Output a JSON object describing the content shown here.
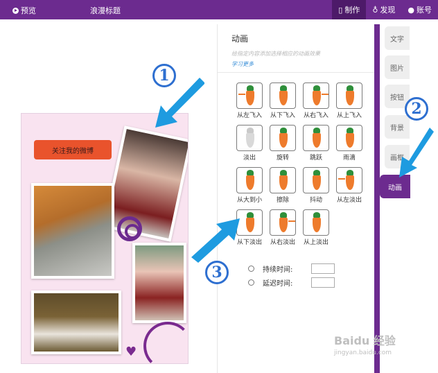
{
  "topbar": {
    "preview": "预览",
    "title": "浪漫标题",
    "nav": [
      "制作",
      "发现",
      "账号"
    ]
  },
  "canvas": {
    "follow_button": "关注我的微博"
  },
  "panel": {
    "title": "动画",
    "hint": "给指定内容添加选择相应的动画效果",
    "learn_more": "学习更多",
    "animations": [
      "从左飞入",
      "从下飞入",
      "从右飞入",
      "从上飞入",
      "淡出",
      "旋转",
      "跳跃",
      "雨滴",
      "从大到小",
      "擦除",
      "抖动",
      "从左淡出",
      "从下淡出",
      "从右淡出",
      "从上淡出"
    ],
    "duration_label": "持续时间:",
    "delay_label": "延迟时间:"
  },
  "tabs": [
    "文字",
    "图片",
    "按钮",
    "背景",
    "画框",
    "动画"
  ],
  "annotations": [
    "1",
    "2",
    "3"
  ],
  "watermark": {
    "main": "Baidu 经验",
    "sub": "jingyan.baidu.com"
  },
  "colors": {
    "brand": "#6c2b8f",
    "accent": "#e9532c",
    "annotation": "#2e6fd0"
  }
}
